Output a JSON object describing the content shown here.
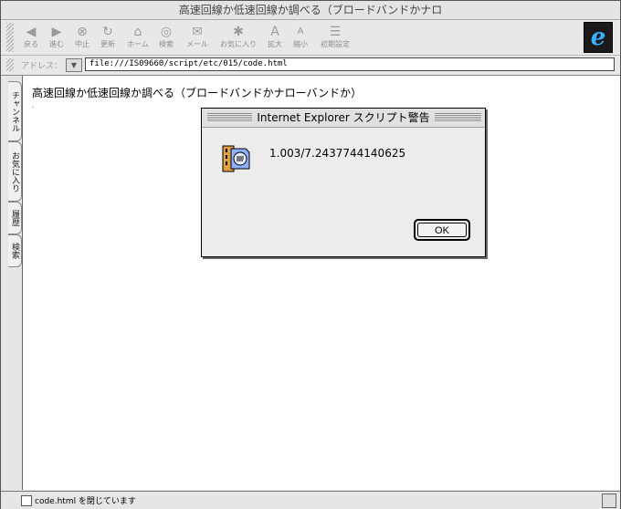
{
  "window": {
    "title": "高速回線か低速回線か調べる（ブロードバンドかナロ"
  },
  "toolbar": {
    "buttons": [
      {
        "label": "戻る",
        "icon": "back-arrow-icon",
        "glyph": "◀"
      },
      {
        "label": "進む",
        "icon": "forward-arrow-icon",
        "glyph": "▶"
      },
      {
        "label": "中止",
        "icon": "stop-icon",
        "glyph": "⊗"
      },
      {
        "label": "更新",
        "icon": "refresh-icon",
        "glyph": "↻"
      },
      {
        "label": "ホーム",
        "icon": "home-icon",
        "glyph": "⌂"
      },
      {
        "label": "検索",
        "icon": "search-icon",
        "glyph": "◎"
      },
      {
        "label": "メール",
        "icon": "mail-icon",
        "glyph": "✉"
      },
      {
        "label": "お気に入り",
        "icon": "favorites-icon",
        "glyph": "✱"
      },
      {
        "label": "拡大",
        "icon": "text-larger-icon",
        "glyph": "A"
      },
      {
        "label": "縮小",
        "icon": "text-smaller-icon",
        "glyph": "A"
      },
      {
        "label": "初期設定",
        "icon": "preferences-icon",
        "glyph": "☰"
      }
    ]
  },
  "address": {
    "label": "アドレス：",
    "url": "file:///IS09660/script/etc/015/code.html"
  },
  "sidetabs": [
    "チャンネル",
    "お気に入り",
    "履歴",
    "検索"
  ],
  "content": {
    "heading": "高速回線か低速回線か調べる（ブロードバンドかナローバンドか）"
  },
  "dialog": {
    "title": "Internet Explorer スクリプト警告",
    "message": "1.003/7.2437744140625",
    "ok_label": "OK"
  },
  "status": {
    "text": "code.html を閉じています"
  },
  "colors": {
    "ie_logo": "#3ab0ff",
    "content_bg": "#ffffff",
    "chrome_bg": "#e8e8e8"
  }
}
